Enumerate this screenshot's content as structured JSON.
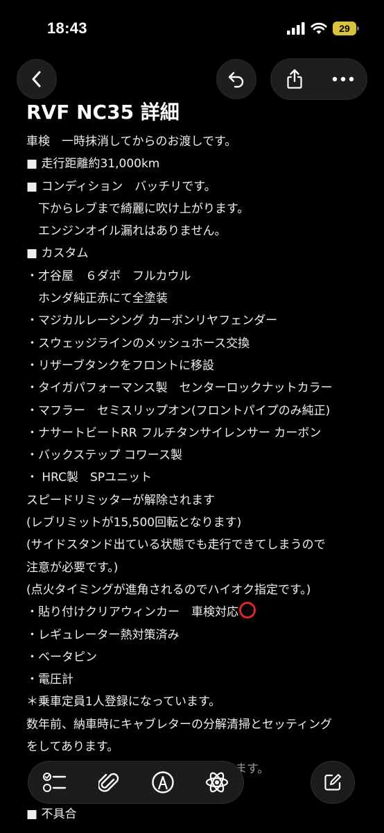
{
  "status_bar": {
    "time": "18:43",
    "battery_level": "29"
  },
  "nav": {
    "back_icon": "chevron-left-icon",
    "undo_icon": "undo-arrow-icon",
    "share_icon": "share-icon",
    "more_icon": "ellipsis-icon"
  },
  "note": {
    "title": "RVF NC35 詳細",
    "lines": [
      "車検　一時抹消してからのお渡しです。",
      " ■ 走行距離約31,000km",
      " ■ コンディション　バッチリです。",
      "　下からレブまで綺麗に吹け上がります。",
      "　エンジンオイル漏れはありません。",
      " ■ カスタム",
      "・才谷屋　６ダボ　フルカウル",
      "　ホンダ純正赤にて全塗装",
      "・マジカルレーシング カーボンリヤフェンダー",
      "・スウェッジラインのメッシュホース交換",
      "・リザーブタンクをフロントに移設",
      "・タイガパフォーマンス製　センターロックナットカラー",
      "・マフラー　セミスリップオン(フロントパイプのみ純正)",
      "・ナサートビートRR フルチタンサイレンサー カーボン",
      "・バックステップ  コワース製",
      "・ HRC製　SPユニット",
      "スピードリミッターが解除されます",
      "(レブリミットが15,500回転となります)",
      "(サイドスタンド出ている状態でも走行できてしまうので",
      "注意が必要です。)",
      "(点火タイミングが進角されるのでハイオク指定です。)",
      "・貼り付けクリアウィンカー　車検対応",
      "・レギュレーター熱対策済み",
      "・ベータピン",
      "・電圧計",
      "＊乗車定員1人登録になっています。",
      "数年前、納車時にキャブレターの分解清掃とセッティング",
      "をしてあります。",
      "",
      "",
      " ■ 不具合"
    ],
    "partial_line_fragment": "ます。",
    "circle_mark_color": "#e0262a"
  },
  "toolbar": {
    "checklist_icon": "checklist-icon",
    "attachment_icon": "paperclip-icon",
    "markup_icon": "pen-markup-icon",
    "ai_icon": "apple-intelligence-icon",
    "compose_icon": "compose-icon"
  }
}
